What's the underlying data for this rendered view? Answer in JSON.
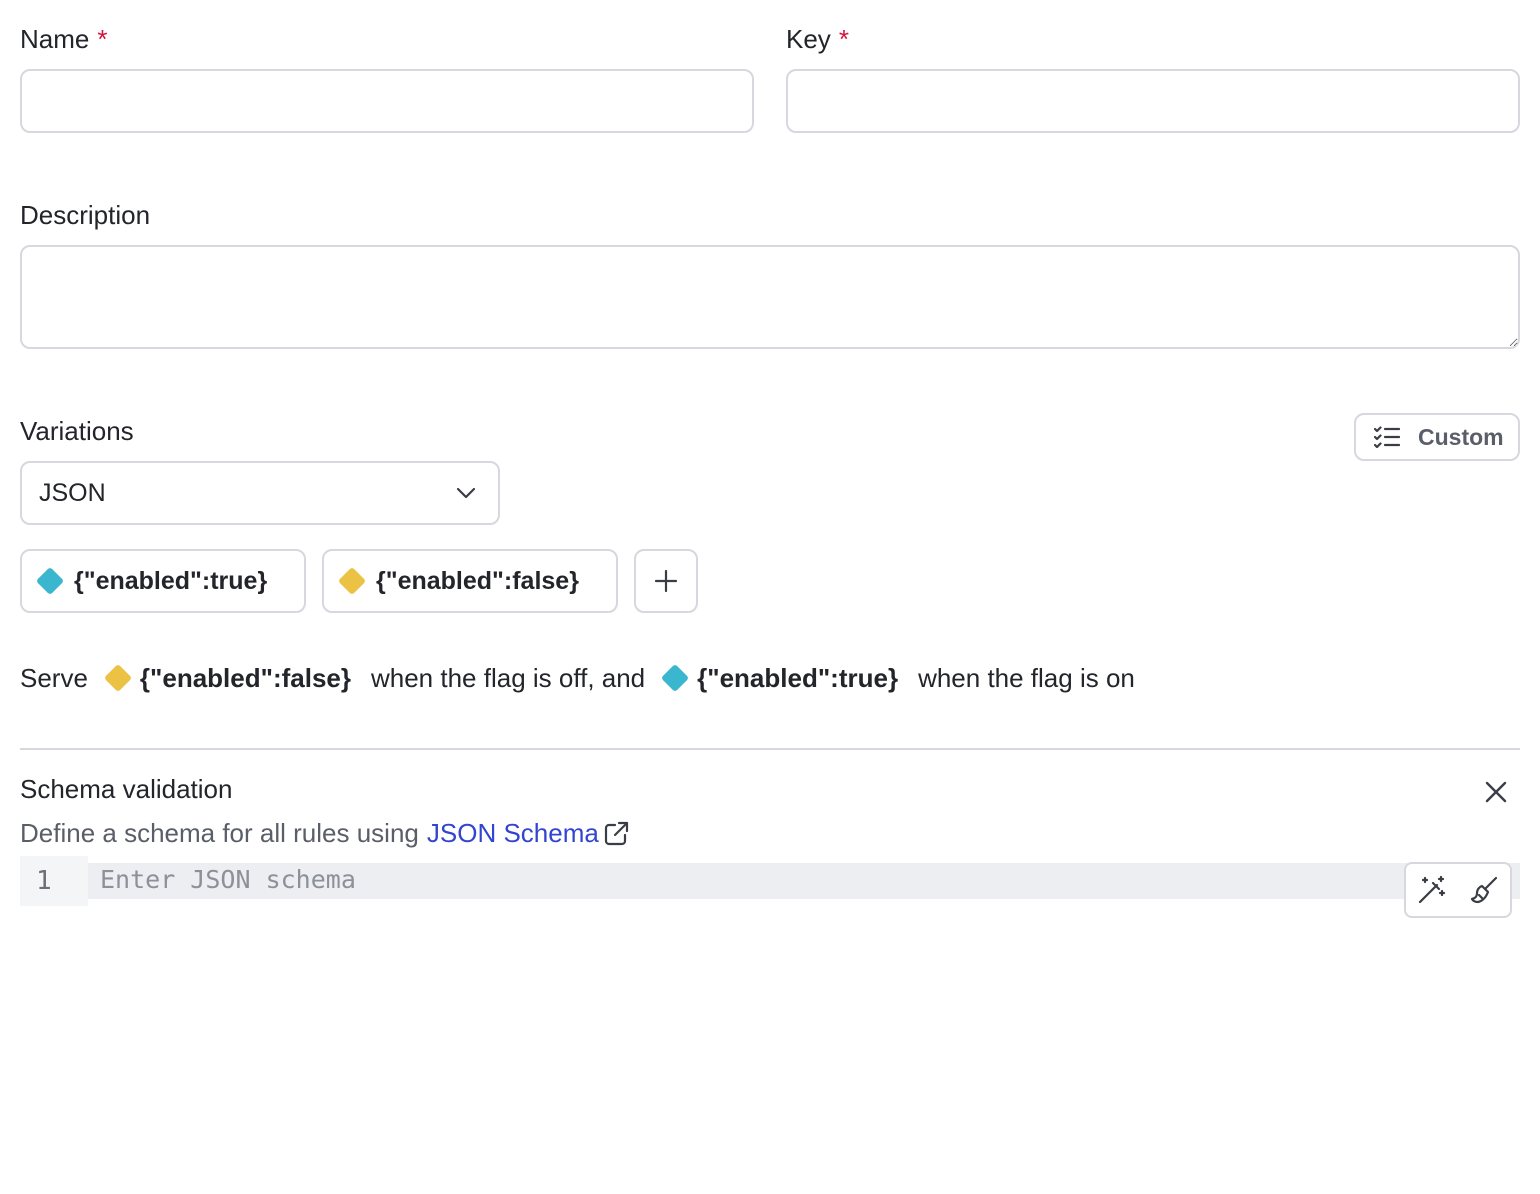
{
  "form": {
    "name": {
      "label": "Name",
      "required_mark": "*",
      "value": ""
    },
    "key": {
      "label": "Key",
      "required_mark": "*",
      "value": ""
    },
    "description": {
      "label": "Description",
      "value": ""
    }
  },
  "variations": {
    "label": "Variations",
    "custom_button": "Custom",
    "type_select": {
      "selected": "JSON"
    },
    "items": [
      {
        "label": "{\"enabled\":true}",
        "color": "#3ab7cf"
      },
      {
        "label": "{\"enabled\":false}",
        "color": "#ecc244"
      }
    ],
    "add_icon": "plus-icon"
  },
  "serve": {
    "prefix": "Serve",
    "off_value": "{\"enabled\":false}",
    "middle": "when the flag is off, and",
    "on_value": "{\"enabled\":true}",
    "suffix": "when the flag is on"
  },
  "schema": {
    "title": "Schema validation",
    "description_prefix": "Define a schema for all rules using",
    "link_text": "JSON Schema",
    "editor": {
      "line_number": "1",
      "placeholder": "Enter JSON schema"
    }
  },
  "colors": {
    "on": "#3ab7cf",
    "off": "#ecc244",
    "link": "#3345d0",
    "required": "#d0143c"
  }
}
